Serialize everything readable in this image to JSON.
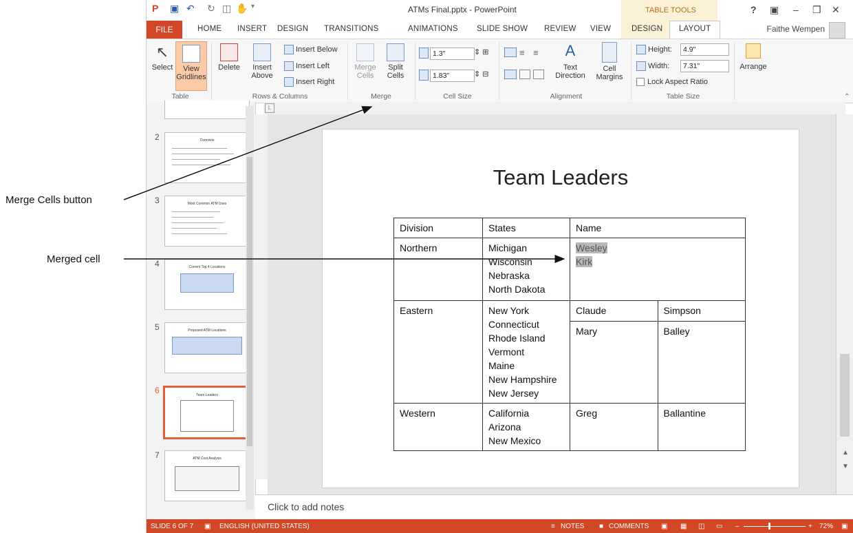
{
  "window": {
    "title": "ATMs Final.pptx - PowerPoint",
    "contextual_group": "TABLE TOOLS",
    "user_name": "Faithe Wempen"
  },
  "tabs": [
    "FILE",
    "HOME",
    "INSERT",
    "DESIGN",
    "TRANSITIONS",
    "ANIMATIONS",
    "SLIDE SHOW",
    "REVIEW",
    "VIEW",
    "DESIGN",
    "LAYOUT"
  ],
  "ribbon": {
    "table_group": {
      "label": "Table",
      "select": "Select",
      "view_gridlines_1": "View",
      "view_gridlines_2": "Gridlines"
    },
    "rows_columns_group": {
      "label": "Rows & Columns",
      "delete": "Delete",
      "insert_above_1": "Insert",
      "insert_above_2": "Above",
      "insert_below": "Insert Below",
      "insert_left": "Insert Left",
      "insert_right": "Insert Right"
    },
    "merge_group": {
      "label": "Merge",
      "merge_cells_1": "Merge",
      "merge_cells_2": "Cells",
      "split_cells_1": "Split",
      "split_cells_2": "Cells"
    },
    "cell_size_group": {
      "label": "Cell Size",
      "height_value": "1.3\"",
      "width_value": "1.83\""
    },
    "alignment_group": {
      "label": "Alignment",
      "text_direction_1": "Text",
      "text_direction_2": "Direction",
      "cell_margins_1": "Cell",
      "cell_margins_2": "Margins"
    },
    "table_size_group": {
      "label": "Table Size",
      "height_label": "Height:",
      "height_value": "4.9\"",
      "width_label": "Width:",
      "width_value": "7.31\"",
      "lock_aspect": "Lock Aspect Ratio"
    },
    "arrange_group": {
      "arrange": "Arrange"
    }
  },
  "thumbnails": [
    {
      "num": "2",
      "title": "Overview"
    },
    {
      "num": "3",
      "title": "Most Common ATM Uses"
    },
    {
      "num": "4",
      "title": "Current Top 4 Locations"
    },
    {
      "num": "5",
      "title": "Proposed ATM Locations"
    },
    {
      "num": "6",
      "title": "Team Leaders"
    },
    {
      "num": "7",
      "title": "ATM Cost Analysis"
    }
  ],
  "slide": {
    "title": "Team Leaders",
    "table": {
      "header": [
        "Division",
        "States",
        "Name"
      ],
      "northern": {
        "division": "Northern",
        "states": [
          "Michigan",
          "Wisconsin",
          "Nebraska",
          "North Dakota"
        ],
        "name_1": "Wesley",
        "name_2": "Kirk"
      },
      "eastern": {
        "division": "Eastern",
        "states": [
          "New York",
          "Connecticut",
          "Rhode Island",
          "Vermont",
          "Maine",
          "New Hampshire",
          "New Jersey"
        ],
        "first_1": "Claude",
        "last_1": "Simpson",
        "first_2": "Mary",
        "last_2": "Balley"
      },
      "western": {
        "division": "Western",
        "states": [
          "California",
          "Arizona",
          "New Mexico"
        ],
        "first": "Greg",
        "last": "Ballantine"
      }
    }
  },
  "notes_placeholder": "Click to add notes",
  "status_bar": {
    "slide_info": "SLIDE 6 OF 7",
    "language": "ENGLISH (UNITED STATES)",
    "notes": "NOTES",
    "comments": "COMMENTS",
    "zoom": "72%"
  },
  "callouts": {
    "merge_cells_button": "Merge Cells button",
    "merged_cell": "Merged cell"
  }
}
